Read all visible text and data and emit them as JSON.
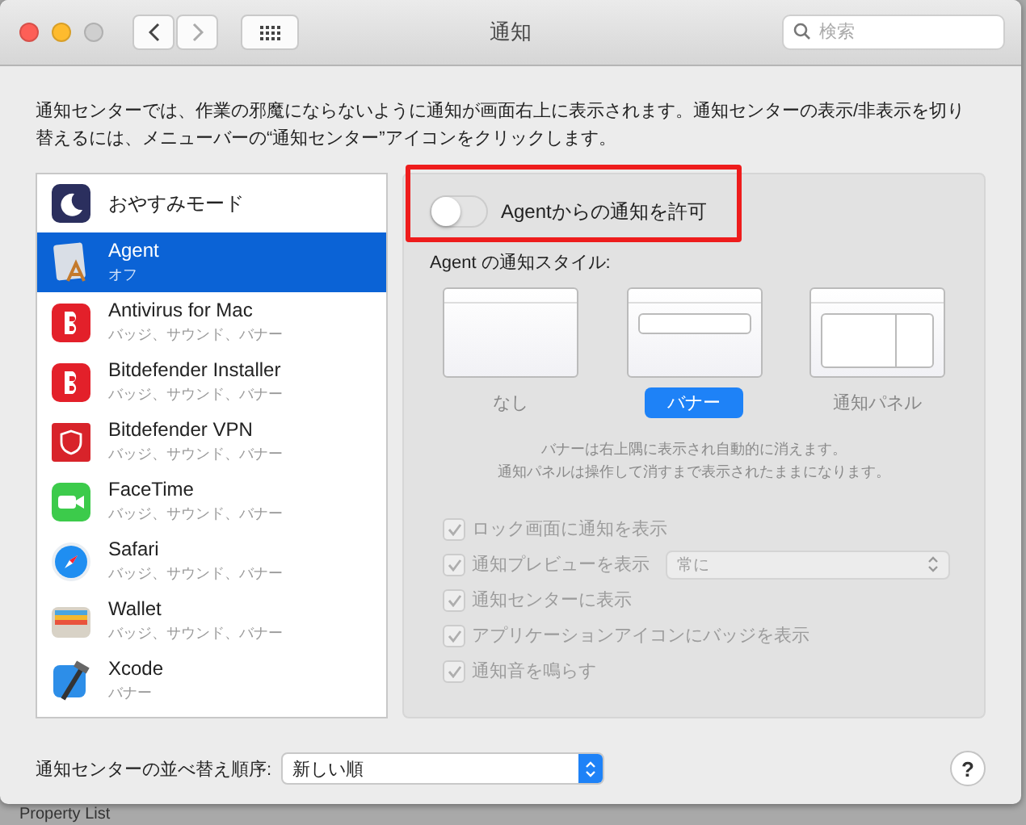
{
  "window": {
    "title": "通知"
  },
  "search": {
    "placeholder": "検索"
  },
  "description": "通知センターでは、作業の邪魔にならないように通知が画面右上に表示されます。通知センターの表示/非表示を切り替えるには、メニューバーの“通知センター”アイコンをクリックします。",
  "apps": [
    {
      "kind": "moon",
      "name": "おやすみモード",
      "selected": false
    },
    {
      "kind": "agent",
      "name": "Agent",
      "subtitle": "オフ",
      "selected": true
    },
    {
      "kind": "bitdefender",
      "name": "Antivirus for Mac",
      "subtitle": "バッジ、サウンド、バナー",
      "selected": false
    },
    {
      "kind": "bitdefender",
      "name": "Bitdefender Installer",
      "subtitle": "バッジ、サウンド、バナー",
      "selected": false
    },
    {
      "kind": "vpn",
      "name": "Bitdefender VPN",
      "subtitle": "バッジ、サウンド、バナー",
      "selected": false
    },
    {
      "kind": "facetime",
      "name": "FaceTime",
      "subtitle": "バッジ、サウンド、バナー",
      "selected": false
    },
    {
      "kind": "safari",
      "name": "Safari",
      "subtitle": "バッジ、サウンド、バナー",
      "selected": false
    },
    {
      "kind": "wallet",
      "name": "Wallet",
      "subtitle": "バッジ、サウンド、バナー",
      "selected": false
    },
    {
      "kind": "xcode",
      "name": "Xcode",
      "subtitle": "バナー",
      "selected": false
    }
  ],
  "allow_toggle": {
    "label": "Agentからの通知を許可",
    "on": false
  },
  "style_heading": "Agent の通知スタイル:",
  "styles": [
    {
      "kind": "none",
      "label": "なし",
      "selected": false
    },
    {
      "kind": "banner",
      "label": "バナー",
      "selected": true
    },
    {
      "kind": "panel",
      "label": "通知パネル",
      "selected": false
    }
  ],
  "style_note": [
    "バナーは右上隅に表示され自動的に消えます。",
    "通知パネルは操作して消すまで表示されたままになります。"
  ],
  "options": [
    {
      "label": "ロック画面に通知を表示",
      "checked": true,
      "disabled": true
    },
    {
      "label": "通知プレビューを表示",
      "checked": true,
      "disabled": true,
      "select": "常に"
    },
    {
      "label": "通知センターに表示",
      "checked": true,
      "disabled": true
    },
    {
      "label": "アプリケーションアイコンにバッジを表示",
      "checked": true,
      "disabled": true
    },
    {
      "label": "通知音を鳴らす",
      "checked": true,
      "disabled": true
    }
  ],
  "sort": {
    "label": "通知センターの並べ替え順序:",
    "value": "新しい順"
  },
  "help": "?",
  "background_window": {
    "title": "Property List"
  }
}
